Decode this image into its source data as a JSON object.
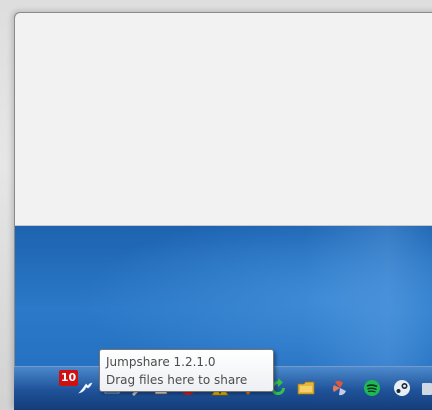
{
  "tooltip": {
    "title": "Jumpshare 1.2.1.0",
    "subtitle": "Drag files here to share"
  },
  "tray": {
    "badge_count": "10",
    "icons": [
      "jumpshare-icon",
      "network-icon",
      "tools-icon",
      "edit-icon",
      "antivirus-icon",
      "warning-icon",
      "refresh-icon",
      "folder-icon",
      "fan-icon",
      "spotify-icon",
      "steam-icon",
      "overflow-icon"
    ]
  },
  "colors": {
    "desktop_blue": "#2b79c8",
    "badge_red": "#d01010",
    "spotify_green": "#1db954"
  }
}
